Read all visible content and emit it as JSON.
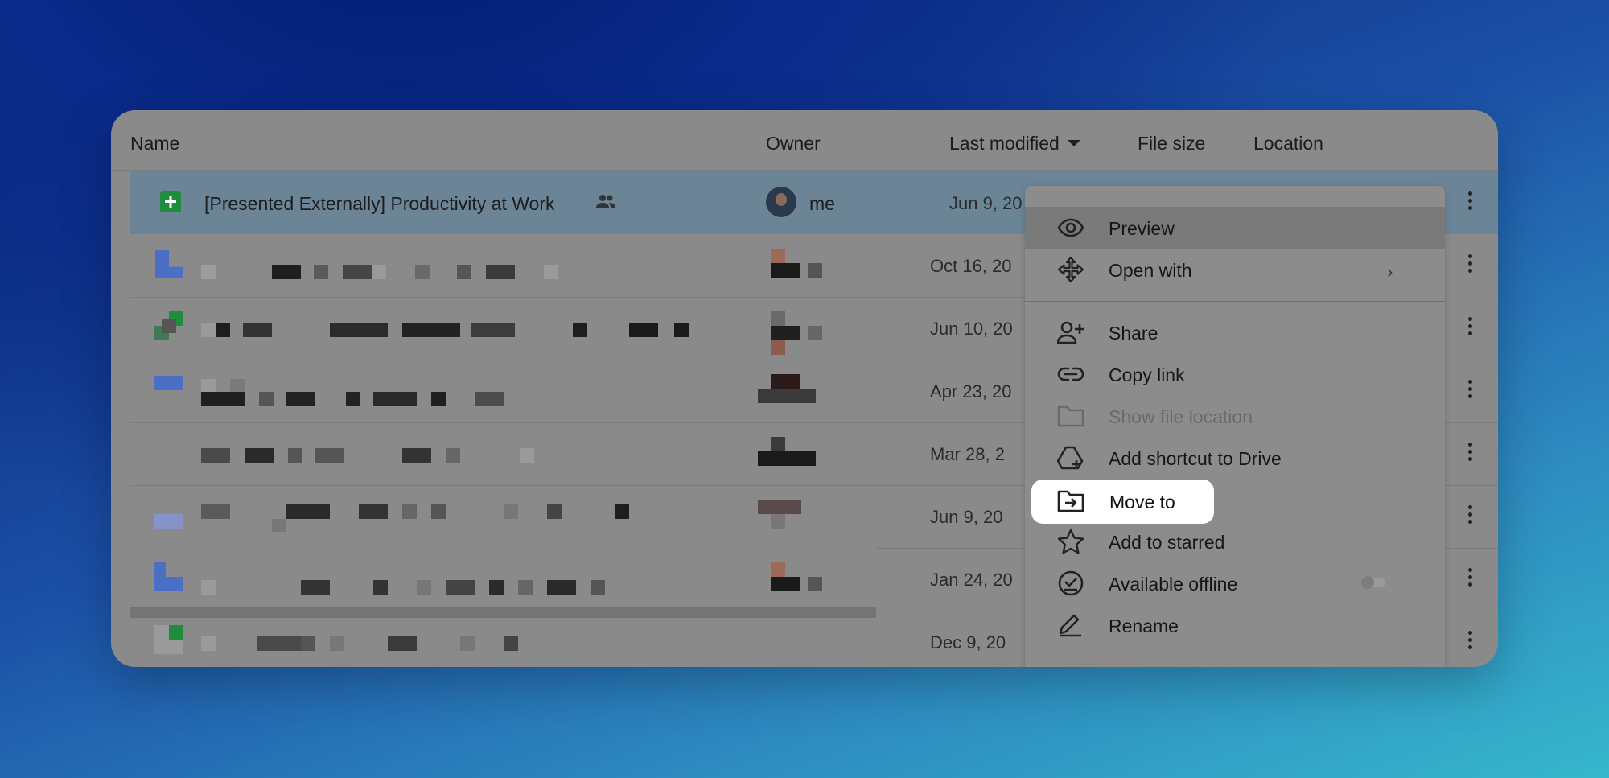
{
  "columns": {
    "name": "Name",
    "owner": "Owner",
    "last_modified": "Last modified",
    "file_size": "File size",
    "location": "Location"
  },
  "rows": [
    {
      "name": "[Presented Externally] Productivity at Work",
      "owner": "me",
      "date": "Jun 9, 20",
      "icon": "sheets-icon",
      "selected": true
    },
    {
      "date": "Oct 16, 20",
      "icon": "docs-icon"
    },
    {
      "date": "Jun 10, 20",
      "icon": "sheets-icon"
    },
    {
      "date": "Apr 23, 20",
      "icon": "docs-icon"
    },
    {
      "date": "Mar 28, 2",
      "icon": "file-icon"
    },
    {
      "date": "Jun 9, 20",
      "icon": "docs-icon"
    },
    {
      "date": "Jan 24, 20",
      "icon": "docs-icon"
    },
    {
      "date": "Dec 9, 20",
      "icon": "sheets-icon"
    }
  ],
  "context_menu": {
    "items": [
      {
        "label": "Preview",
        "icon": "eye-icon"
      },
      {
        "label": "Open with",
        "icon": "move-arrows-icon"
      },
      {
        "label": "Share",
        "icon": "person-add-icon"
      },
      {
        "label": "Copy link",
        "icon": "link-icon"
      },
      {
        "label": "Show file location",
        "icon": "folder-icon",
        "disabled": true
      },
      {
        "label": "Add shortcut to Drive",
        "icon": "drive-shortcut-icon"
      },
      {
        "label": "Move to",
        "icon": "folder-move-icon",
        "highlighted": true
      },
      {
        "label": "Add to starred",
        "icon": "star-icon"
      },
      {
        "label": "Available offline",
        "icon": "offline-check-icon",
        "toggle": false
      },
      {
        "label": "Rename",
        "icon": "pencil-icon"
      }
    ]
  },
  "colors": {
    "selected_row": "#6b8597",
    "sheets_green": "#1e8e3e",
    "docs_blue": "#4a6fc4"
  }
}
